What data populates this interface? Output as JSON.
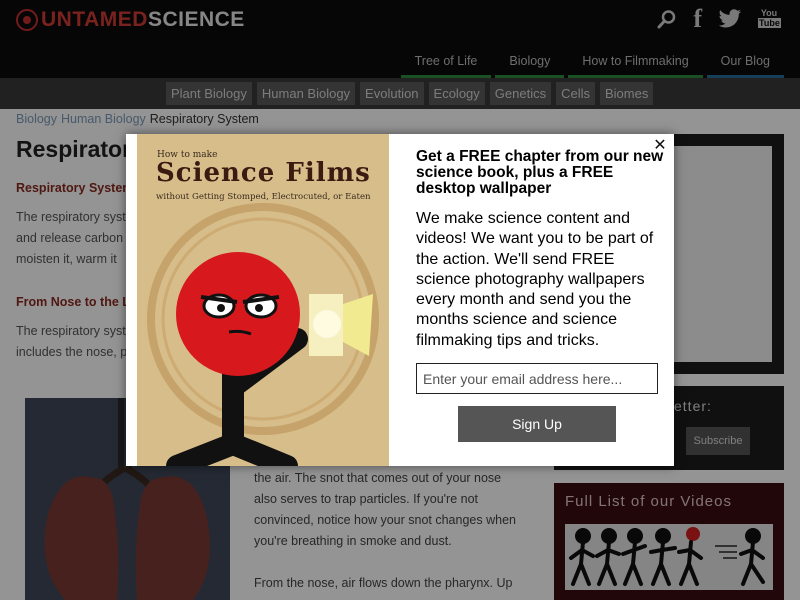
{
  "logo": {
    "part1": "UNTAMED",
    "part2": "SCIENCE"
  },
  "main_nav": [
    {
      "label": "Tree of Life"
    },
    {
      "label": "Biology"
    },
    {
      "label": "How to Filmmaking"
    },
    {
      "label": "Our Blog"
    }
  ],
  "sub_nav": [
    {
      "label": "Plant Biology"
    },
    {
      "label": "Human Biology"
    },
    {
      "label": "Evolution"
    },
    {
      "label": "Ecology"
    },
    {
      "label": "Genetics"
    },
    {
      "label": "Cells"
    },
    {
      "label": "Biomes"
    }
  ],
  "breadcrumb": {
    "item1": "Biology",
    "item2": "Human Biology",
    "current": "Respiratory System"
  },
  "article": {
    "title": "Respiratory",
    "section1_heading": "Respiratory System",
    "para1_line1": "The respiratory syst",
    "para1_line2": "and release carbon",
    "para1_line3": "moisten it, warm it",
    "section2_heading": "From Nose to the L",
    "para2_line1": "The respiratory syst",
    "para2_line2": "includes the nose, p",
    "body_lines": [
      "the air.  The snot that comes out of your nose",
      "also serves to trap particles. If you're not",
      "convinced, notice how your snot changes when",
      "you're breathing in smoke and dust.",
      "",
      "From the nose, air flows down the pharynx.  Up"
    ]
  },
  "sidebar": {
    "newsletter_title": "etter:",
    "subscribe_label": "Subscribe",
    "videos_title": "Full List of our Videos"
  },
  "modal": {
    "book_how_to_make": "How to make",
    "book_title": "Science Films",
    "book_subtitle": "without Getting Stomped, Electrocuted, or Eaten",
    "headline": "Get a FREE chapter from our new science book, plus a FREE desktop wallpaper",
    "body": "We make science content and videos! We want you to be part of the action. We'll send FREE science photography wallpapers every month and send you the months science and science filmmaking tips and tricks.",
    "email_placeholder": "Enter your email address here...",
    "signup_label": "Sign Up",
    "close_glyph": "✕"
  }
}
